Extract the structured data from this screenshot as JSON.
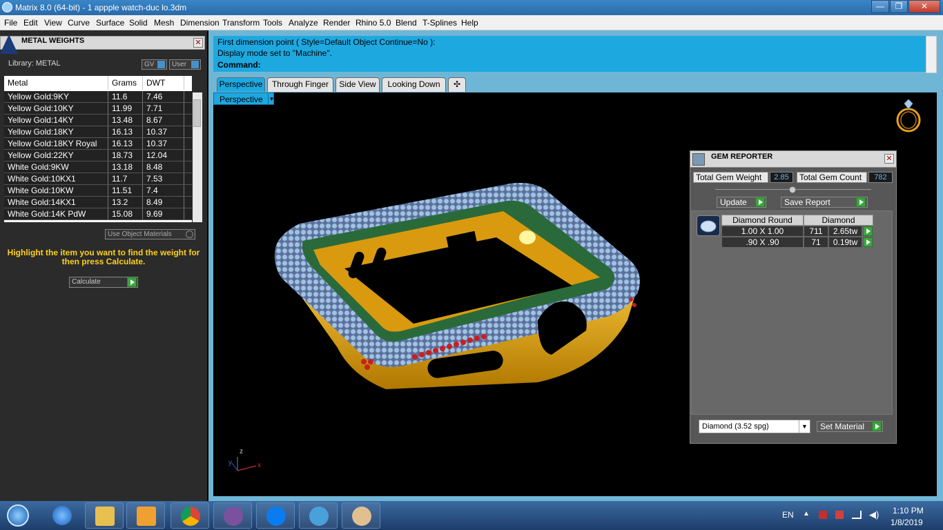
{
  "window": {
    "title": "Matrix 8.0 (64-bit) - 1 appple watch-duc lo.3dm",
    "minimize": "—",
    "maximize": "❐",
    "close": "✕"
  },
  "menu": [
    "File",
    "Edit",
    "View",
    "Curve",
    "Surface",
    "Solid",
    "Mesh",
    "Dimension",
    "Transform",
    "Tools",
    "Analyze",
    "Render",
    "Rhino 5.0",
    "Blend",
    "T-Splines",
    "Help"
  ],
  "metal_panel": {
    "title": "METAL WEIGHTS",
    "close": "✕",
    "library": "Library: METAL",
    "gv_label": "GV",
    "user_label": "User",
    "headers": [
      "Metal",
      "Grams",
      "DWT"
    ],
    "rows": [
      [
        "Yellow Gold:9KY",
        "11.6",
        "7.46"
      ],
      [
        "Yellow Gold:10KY",
        "11.99",
        "7.71"
      ],
      [
        "Yellow Gold:14KY",
        "13.48",
        "8.67"
      ],
      [
        "Yellow Gold:18KY",
        "16.13",
        "10.37"
      ],
      [
        "Yellow Gold:18KY Royal",
        "16.13",
        "10.37"
      ],
      [
        "Yellow Gold:22KY",
        "18.73",
        "12.04"
      ],
      [
        "White Gold:9KW",
        "13.18",
        "8.48"
      ],
      [
        "White Gold:10KX1",
        "11.7",
        "7.53"
      ],
      [
        "White Gold:10KW",
        "11.51",
        "7.4"
      ],
      [
        "White Gold:14KX1",
        "13.2",
        "8.49"
      ],
      [
        "White Gold:14K PdW",
        "15.08",
        "9.69"
      ]
    ],
    "use_object_materials": "Use Object Materials",
    "hint": "Highlight the item you want to find the weight for then press Calculate.",
    "calculate": "Calculate"
  },
  "command": {
    "line1": "First dimension point ( Style=Default  Object  Continue=No ):",
    "line2": "Display mode set to \"Machine\".",
    "prompt": "Command:"
  },
  "tabs": [
    "Perspective",
    "Through Finger",
    "Side View",
    "Looking Down",
    "✣"
  ],
  "viewport": {
    "label": "Perspective",
    "axis_z": "z",
    "axis_y": "y",
    "axis_x": "x"
  },
  "gem_reporter": {
    "title": "GEM REPORTER",
    "close": "✕",
    "total_weight_label": "Total Gem Weight",
    "total_weight": "2.85",
    "total_count_label": "Total Gem Count",
    "total_count": "782",
    "update": "Update",
    "save_report": "Save Report",
    "col1": "Diamond Round",
    "col2": "Diamond",
    "rows": [
      {
        "size": "1.00 X 1.00",
        "count": "711",
        "weight": "2.65tw"
      },
      {
        "size": ".90 X .90",
        "count": "71",
        "weight": "0.19tw"
      }
    ],
    "material": "Diamond     (3.52 spg)",
    "set_material": "Set Material"
  },
  "tray": {
    "lang": "EN",
    "time": "1:10 PM",
    "date": "1/8/2019"
  },
  "colors": {
    "accent": "#1ea8e0",
    "panel": "#2b2b2b",
    "gold": "#e8a820",
    "hint": "#ffd21a"
  }
}
